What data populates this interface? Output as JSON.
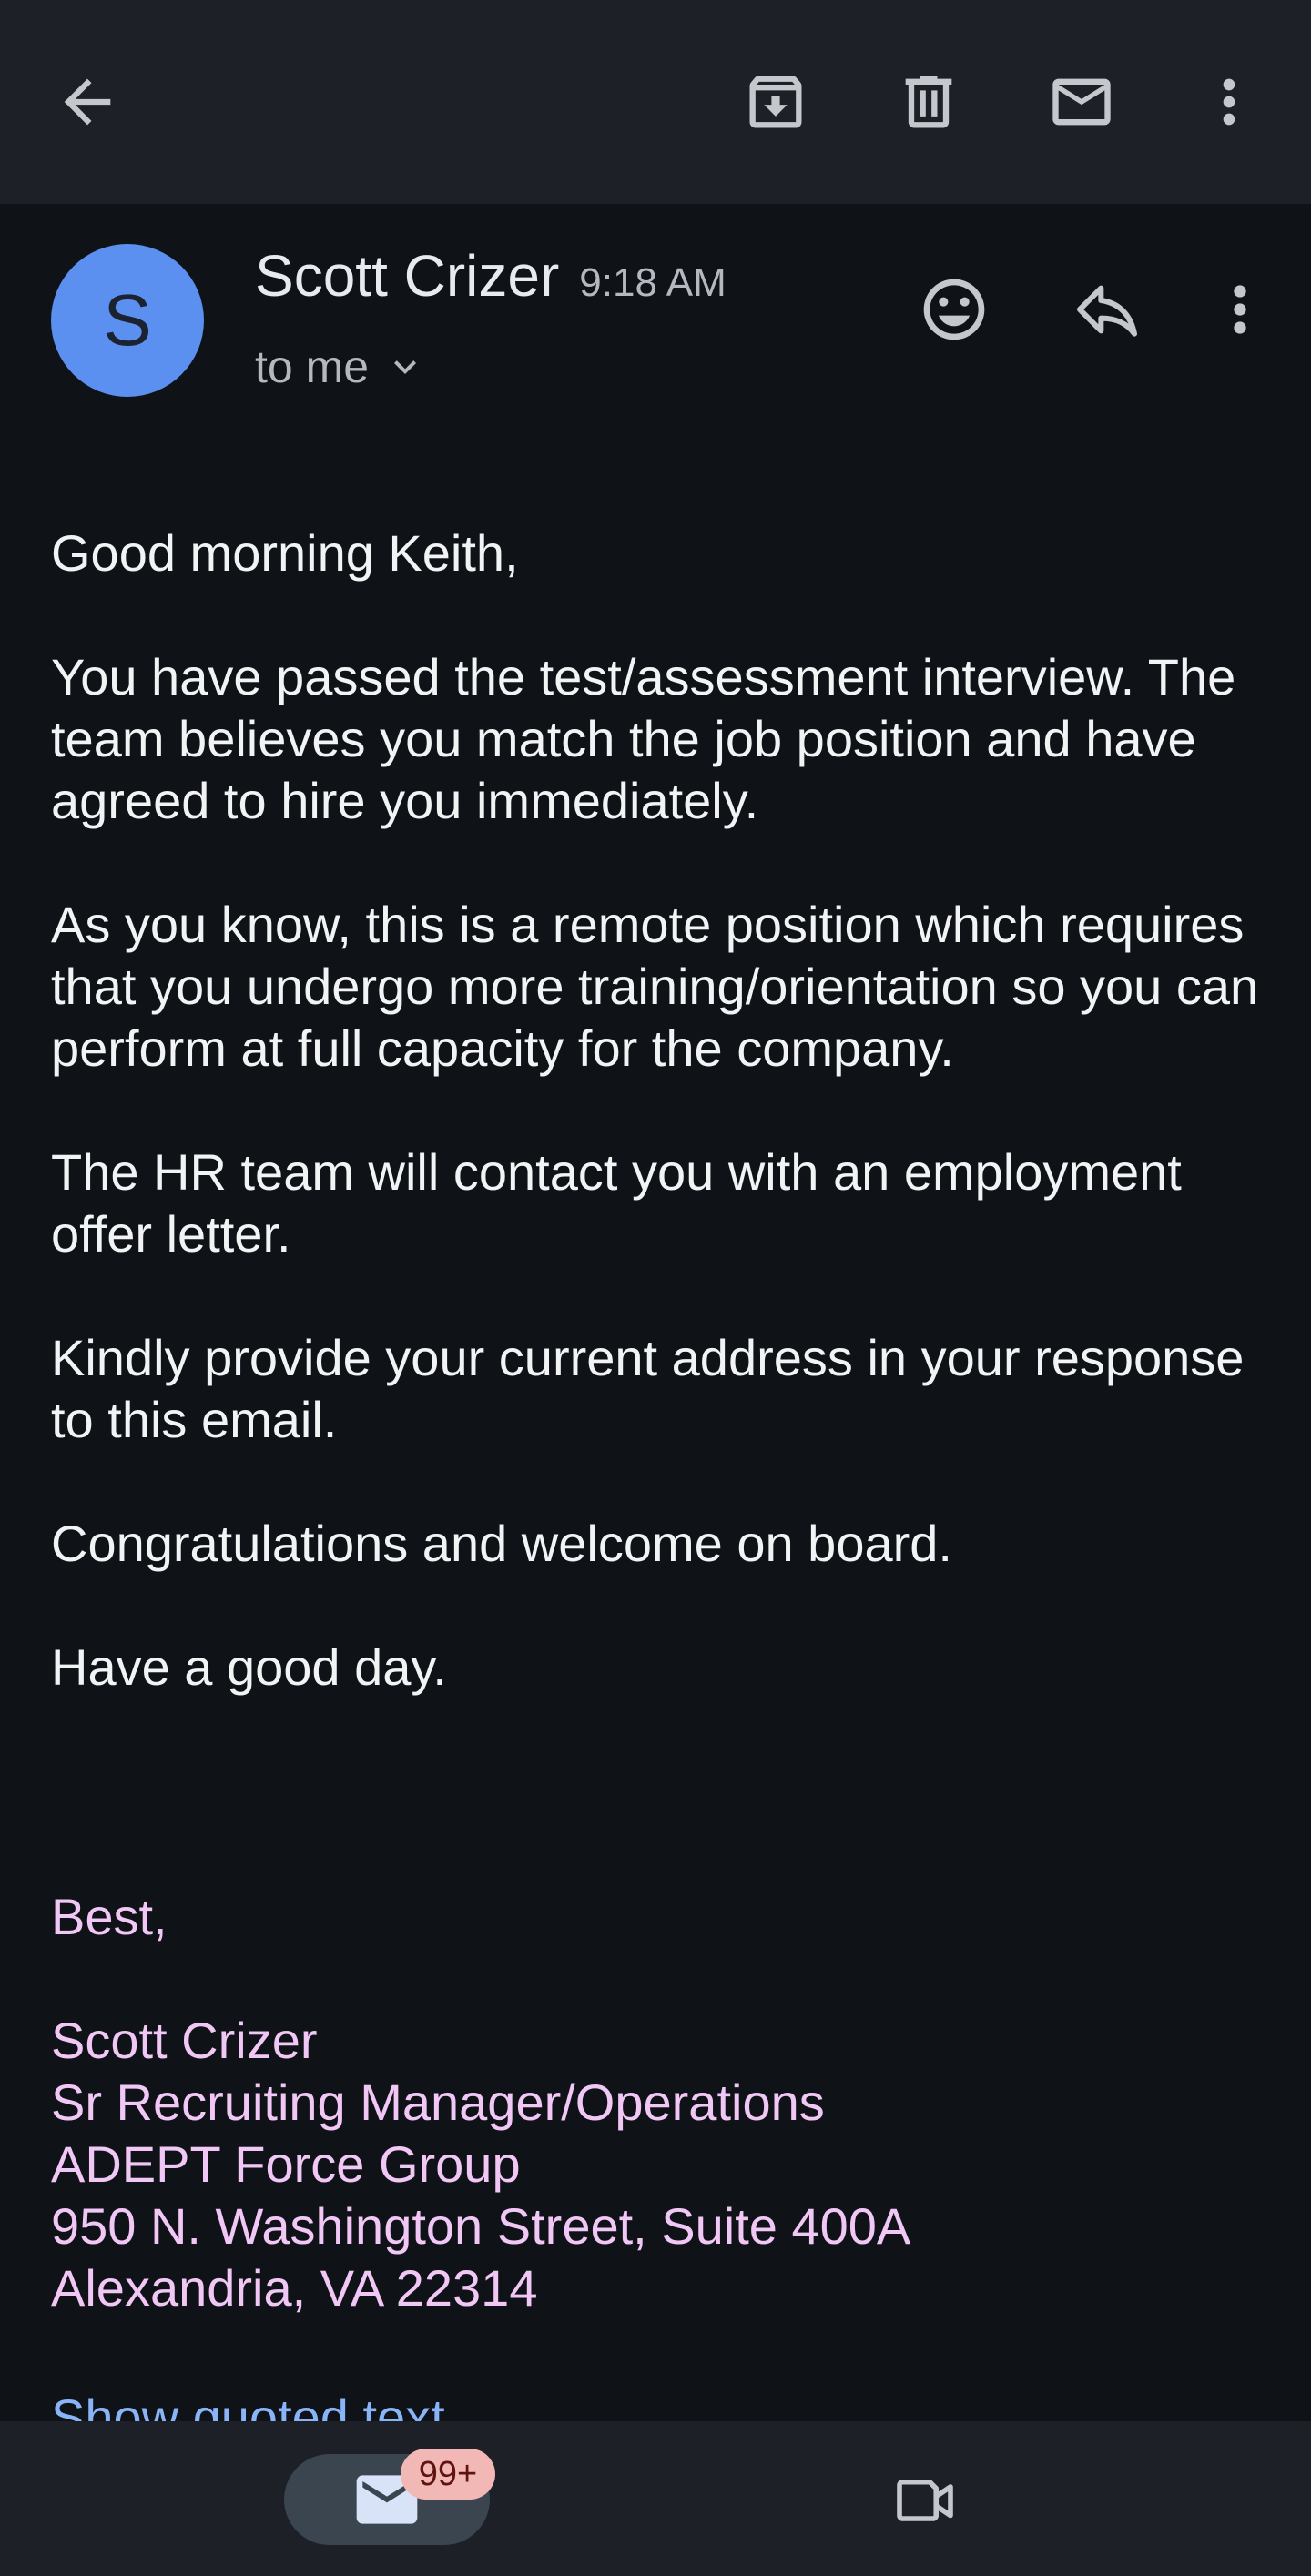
{
  "toolbar": {
    "icons": [
      "back-arrow-icon",
      "archive-icon",
      "delete-icon",
      "mark-unread-icon",
      "more-vert-icon"
    ]
  },
  "message": {
    "avatar_letter": "S",
    "avatar_color": "#5b8ff0",
    "sender": "Scott Crizer",
    "time": "9:18 AM",
    "recipient": "to me"
  },
  "body": {
    "greeting": "Good morning Keith,",
    "paragraphs": [
      "You have passed the test/assessment interview. The team believes you match the job position and have agreed to hire you immediately.",
      "As you know, this is a remote position which requires that you undergo more training/orientation so you can perform at full capacity for the company.",
      "The HR team will contact you with an employment offer letter.",
      "Kindly provide your current address in your response to this email.",
      "Congratulations and welcome on board.",
      "Have a good day."
    ]
  },
  "signature": {
    "closing": "Best,",
    "name": "Scott Crizer",
    "title": "Sr Recruiting Manager/Operations",
    "company": "ADEPT Force Group",
    "address_line1": "950 N. Washington Street, Suite 400A",
    "address_line2": "Alexandria, VA 22314",
    "color": "#f1c7f5"
  },
  "show_quoted_text": "Show quoted text",
  "bottom_nav": {
    "mail_badge": "99+",
    "icons": [
      "mail-icon",
      "meet-video-icon"
    ]
  }
}
